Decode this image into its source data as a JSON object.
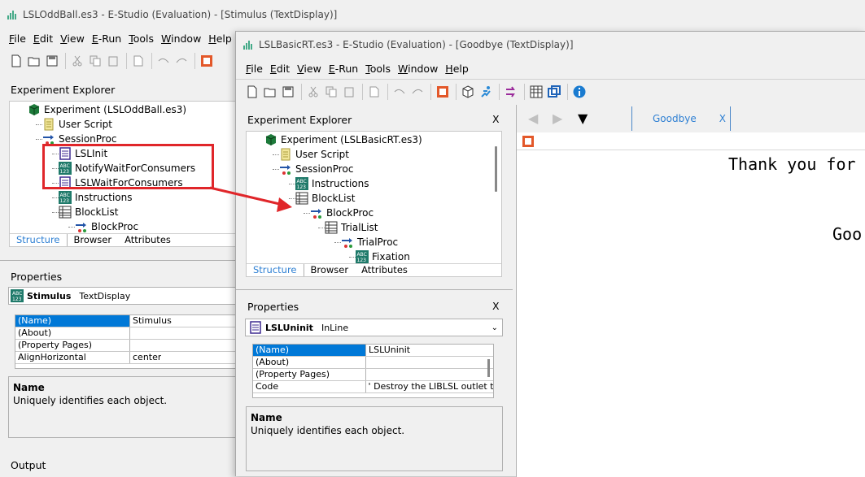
{
  "back_window": {
    "title": "LSLOddBall.es3 - E-Studio (Evaluation) - [Stimulus  (TextDisplay)]",
    "menu": [
      "File",
      "Edit",
      "View",
      "E-Run",
      "Tools",
      "Window",
      "Help"
    ],
    "explorer_title": "Experiment Explorer",
    "tree": [
      {
        "label": "Experiment (LSLOddBall.es3)",
        "icon": "experiment-icon"
      },
      {
        "label": "User Script",
        "icon": "script-icon"
      },
      {
        "label": "SessionProc",
        "icon": "procedure-icon"
      },
      {
        "label": "LSLInit",
        "icon": "inline-icon"
      },
      {
        "label": "NotifyWaitForConsumers",
        "icon": "textdisplay-icon"
      },
      {
        "label": "LSLWaitForConsumers",
        "icon": "inline-icon"
      },
      {
        "label": "Instructions",
        "icon": "textdisplay-icon"
      },
      {
        "label": "BlockList",
        "icon": "list-icon"
      },
      {
        "label": "BlockProc",
        "icon": "procedure-icon"
      }
    ],
    "tabs": [
      "Structure",
      "Browser",
      "Attributes"
    ],
    "properties_title": "Properties",
    "object_name": "Stimulus",
    "object_type": "TextDisplay",
    "props": [
      {
        "name": "(Name)",
        "value": "Stimulus"
      },
      {
        "name": "(About)",
        "value": ""
      },
      {
        "name": "(Property Pages)",
        "value": ""
      },
      {
        "name": "AlignHorizontal",
        "value": "center"
      }
    ],
    "desc_title": "Name",
    "desc_text": "Uniquely identifies each object.",
    "output_title": "Output"
  },
  "front_window": {
    "title": "LSLBasicRT.es3 - E-Studio (Evaluation) - [Goodbye  (TextDisplay)]",
    "menu": [
      "File",
      "Edit",
      "View",
      "E-Run",
      "Tools",
      "Window",
      "Help"
    ],
    "explorer_title": "Experiment Explorer",
    "close": "X",
    "tree": [
      {
        "label": "Experiment (LSLBasicRT.es3)",
        "icon": "experiment-icon"
      },
      {
        "label": "User Script",
        "icon": "script-icon"
      },
      {
        "label": "SessionProc",
        "icon": "procedure-icon"
      },
      {
        "label": "Instructions",
        "icon": "textdisplay-icon"
      },
      {
        "label": "BlockList",
        "icon": "list-icon"
      },
      {
        "label": "BlockProc",
        "icon": "procedure-icon"
      },
      {
        "label": "TrialList",
        "icon": "list-icon"
      },
      {
        "label": "TrialProc",
        "icon": "procedure-icon"
      },
      {
        "label": "Fixation",
        "icon": "textdisplay-icon"
      }
    ],
    "tabs": [
      "Structure",
      "Browser",
      "Attributes"
    ],
    "properties_title": "Properties",
    "object_name": "LSLUninit",
    "object_type": "InLine",
    "props": [
      {
        "name": "(Name)",
        "value": "LSLUninit"
      },
      {
        "name": "(About)",
        "value": ""
      },
      {
        "name": "(Property Pages)",
        "value": ""
      },
      {
        "name": "Code",
        "value": "' Destroy the LIBLSL outlet t"
      }
    ],
    "desc_title": "Name",
    "desc_text": "Uniquely identifies each object.",
    "doc_tab": "Goodbye",
    "doc_text_line1": "Thank you for",
    "doc_text_line2": "Goo"
  },
  "colors": {
    "accent_tab": "#2d7fd3",
    "selection": "#0078d7",
    "annotation": "#e0262a"
  }
}
